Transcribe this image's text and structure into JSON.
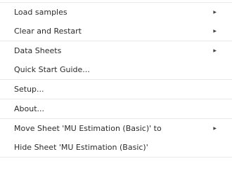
{
  "menu": {
    "groups": [
      {
        "items": [
          {
            "label": "Load samples",
            "has_submenu": true
          },
          {
            "label": "Clear and Restart",
            "has_submenu": true
          }
        ]
      },
      {
        "items": [
          {
            "label": "Data Sheets",
            "has_submenu": true
          },
          {
            "label": "Quick Start Guide...",
            "has_submenu": false
          }
        ]
      },
      {
        "items": [
          {
            "label": "Setup...",
            "has_submenu": false
          }
        ]
      },
      {
        "items": [
          {
            "label": "About...",
            "has_submenu": false
          }
        ]
      },
      {
        "items": [
          {
            "label": "Move Sheet 'MU Estimation (Basic)' to",
            "has_submenu": true
          },
          {
            "label": "Hide Sheet 'MU Estimation (Basic)'",
            "has_submenu": false
          }
        ]
      }
    ],
    "submenu_arrow_icon": "triangle-right-icon",
    "arrow_glyph": "▶"
  }
}
